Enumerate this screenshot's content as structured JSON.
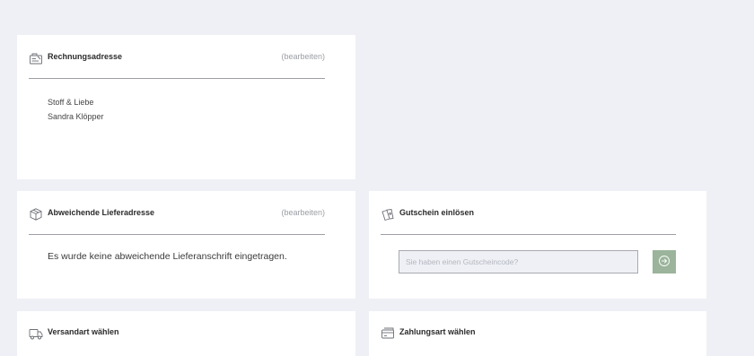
{
  "billing": {
    "title": "Rechnungsadresse",
    "edit_label": "(bearbeiten)",
    "address_lines": [
      "Stoff & Liebe",
      "Sandra Klöpper"
    ],
    "icon": "address-card-icon"
  },
  "delivery": {
    "title": "Abweichende Lieferadresse",
    "edit_label": "(bearbeiten)",
    "message": "Es wurde keine abweichende Lieferanschrift eingetragen.",
    "icon": "package-box-icon"
  },
  "voucher": {
    "title": "Gutschein einlösen",
    "placeholder": "Sie haben einen Gutscheincode?",
    "value": "",
    "icon": "voucher-tickets-icon",
    "submit_icon": "arrow-right-circle-icon",
    "submit_color": "#9bb49b"
  },
  "shipping": {
    "title": "Versandart wählen",
    "icon": "delivery-truck-icon"
  },
  "payment": {
    "title": "Zahlungsart wählen",
    "icon": "payment-card-icon"
  },
  "colors": {
    "page_background": "#eff0f5",
    "panel_background": "#ffffff",
    "muted_text": "#9a9ea4",
    "accent_green": "#9bb49b"
  }
}
